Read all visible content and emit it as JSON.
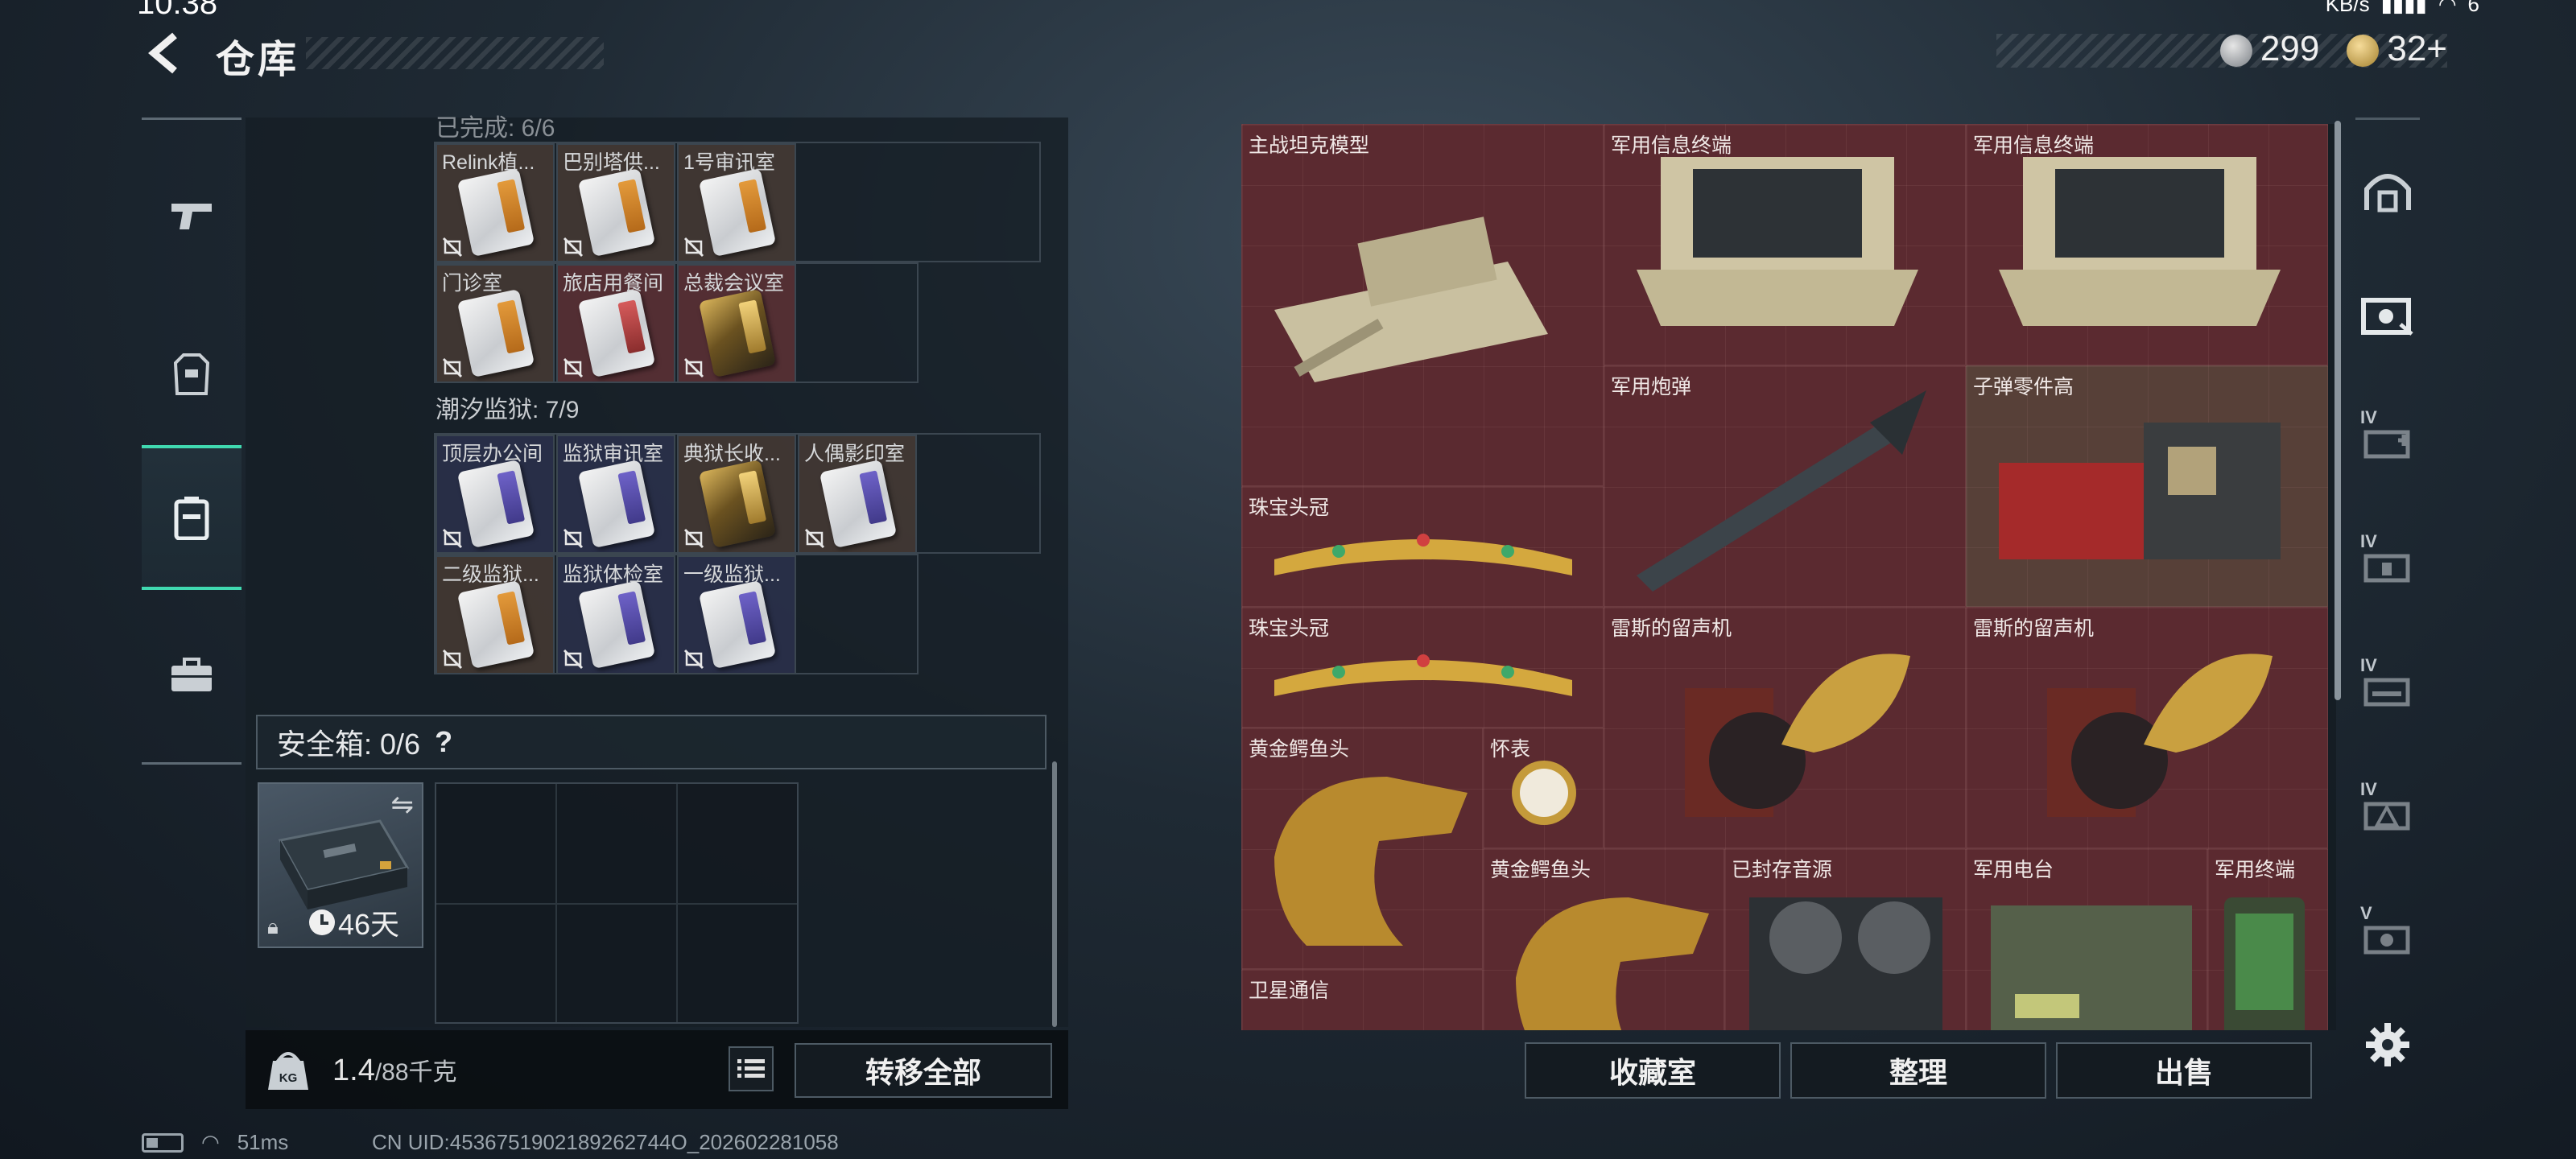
{
  "statusbar": {
    "time": "10:38",
    "network_speed": "KB/s",
    "signal": "6"
  },
  "header": {
    "title": "仓库"
  },
  "currency": {
    "silver": "299",
    "gold": "32",
    "gold_add": "+"
  },
  "left_nav": {
    "items": [
      "weapons",
      "equipment",
      "backpack",
      "toolbox"
    ],
    "active_index": 2
  },
  "backpack": {
    "section_1_header_fragment": "已完成: 6/6",
    "section_1_items": [
      {
        "label": "Relink植...",
        "color": "orange"
      },
      {
        "label": "巴别塔供...",
        "color": "orange"
      },
      {
        "label": "1号审讯室",
        "color": "orange"
      },
      {
        "label": "门诊室",
        "color": "orange"
      },
      {
        "label": "旅店用餐间",
        "color": "red"
      },
      {
        "label": "总裁会议室",
        "color": "gold"
      }
    ],
    "section_2_title": "潮汐监狱: 7/9",
    "section_2_items": [
      {
        "label": "顶层办公间",
        "color": "purple"
      },
      {
        "label": "监狱审讯室",
        "color": "purple"
      },
      {
        "label": "典狱长收...",
        "color": "gold"
      },
      {
        "label": "人偶影印室",
        "color": "purple"
      },
      {
        "label": "二级监狱...",
        "color": "orange"
      },
      {
        "label": "监狱体检室",
        "color": "purple"
      },
      {
        "label": "一级监狱...",
        "color": "purple"
      }
    ],
    "safe_box": {
      "title": "安全箱: 0/6",
      "help": "?",
      "timer": "46天"
    },
    "weight": {
      "current": "1.4",
      "capacity": "/88千克"
    },
    "transfer_all_label": "转移全部"
  },
  "warehouse": {
    "items": [
      {
        "label": "主战坦克模型",
        "icon": "tank-icon"
      },
      {
        "label": "军用信息终端",
        "icon": "terminal-icon"
      },
      {
        "label": "军用信息终端",
        "icon": "terminal-icon"
      },
      {
        "label": "军用炮弹",
        "icon": "missile-icon"
      },
      {
        "label": "子弹零件高",
        "icon": "ammo-parts-icon"
      },
      {
        "label": "珠宝头冠",
        "icon": "tiara-icon"
      },
      {
        "label": "珠宝头冠",
        "icon": "tiara-icon"
      },
      {
        "label": "雷斯的留声机",
        "icon": "gramophone-icon"
      },
      {
        "label": "雷斯的留声机",
        "icon": "gramophone-icon"
      },
      {
        "label": "黄金鳄鱼头",
        "icon": "gold-croc-icon"
      },
      {
        "label": "怀表",
        "icon": "pocket-watch-icon"
      },
      {
        "label": "黄金鳄鱼头",
        "icon": "gold-croc-icon"
      },
      {
        "label": "已封存音源",
        "icon": "reel-recorder-icon"
      },
      {
        "label": "军用电台",
        "icon": "radio-icon"
      },
      {
        "label": "军用终端",
        "icon": "handheld-terminal-icon"
      },
      {
        "label": "卫星通信",
        "icon": "satellite-icon"
      }
    ],
    "buttons": {
      "collection": "收藏室",
      "sort": "整理",
      "sell": "出售"
    }
  },
  "right_nav": {
    "levels": [
      "IV",
      "IV",
      "IV",
      "IV",
      "V"
    ]
  },
  "bottom_status": {
    "ping": "51ms",
    "uid": "CN UID:4536751902189262744O_202602281058"
  },
  "colors": {
    "accent": "#40d9b0",
    "item_red": "#5b2a30"
  }
}
